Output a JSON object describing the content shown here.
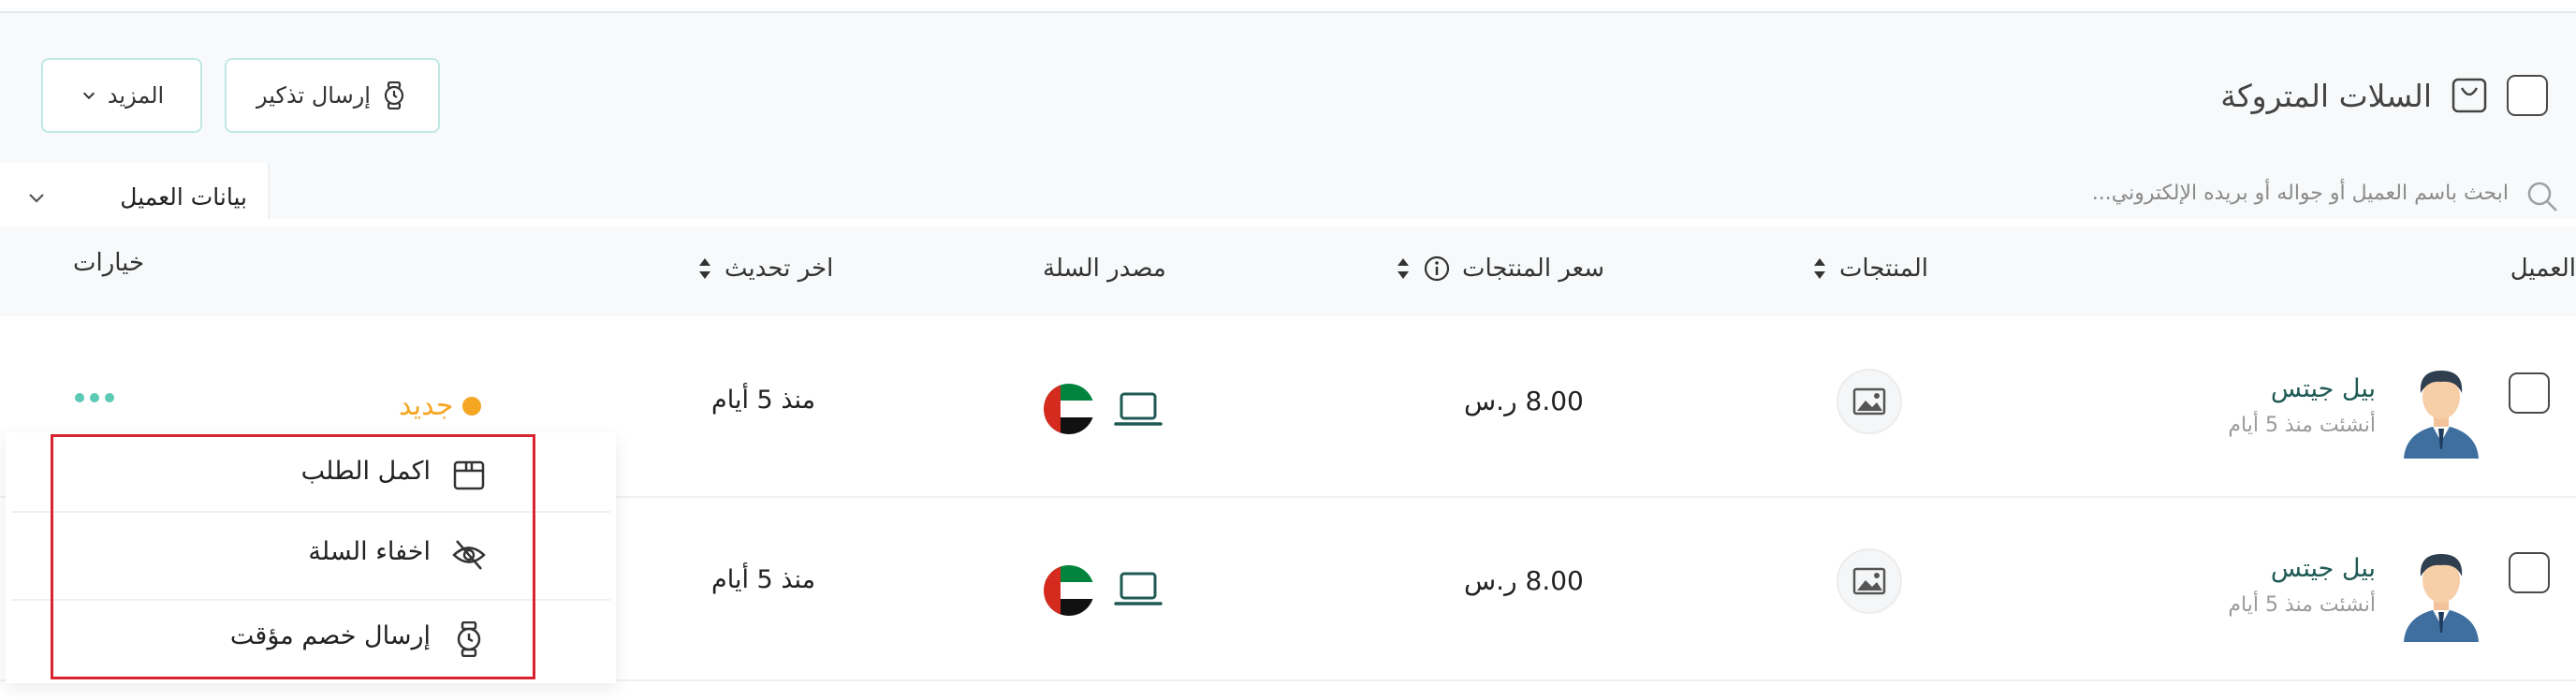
{
  "header": {
    "title": "السلات المتروكة",
    "more_label": "المزيد",
    "remind_label": "إرسال تذكير"
  },
  "search": {
    "placeholder": "ابحث باسم العميل أو جواله أو بريده الإلكتروني...",
    "filter_label": "بيانات العميل"
  },
  "table": {
    "columns": {
      "customer": "العميل",
      "products": "المنتجات",
      "price": "سعر المنتجات",
      "source": "مصدر السلة",
      "updated": "اخر تحديث",
      "options": "خيارات"
    },
    "rows": [
      {
        "name": "بيل جيتس",
        "created": "أنشئت منذ 5 أيام",
        "price": "8.00 ر.س",
        "updated": "منذ 5 أيام",
        "status": "جديد",
        "status_color": "#f5a623"
      },
      {
        "name": "بيل جيتس",
        "created": "أنشئت منذ 5 أيام",
        "price": "8.00 ر.س",
        "updated": "منذ 5 أيام"
      }
    ]
  },
  "dropdown": {
    "items": [
      {
        "label": "اكمل الطلب",
        "icon": "box-icon"
      },
      {
        "label": "اخفاء السلة",
        "icon": "eye-off-icon"
      },
      {
        "label": "إرسال خصم مؤقت",
        "icon": "stopwatch-icon"
      }
    ]
  },
  "colors": {
    "accent": "#5cc9b5",
    "status_new": "#f5a623",
    "highlight": "#d9232e",
    "customer_name": "#1f5a54"
  }
}
